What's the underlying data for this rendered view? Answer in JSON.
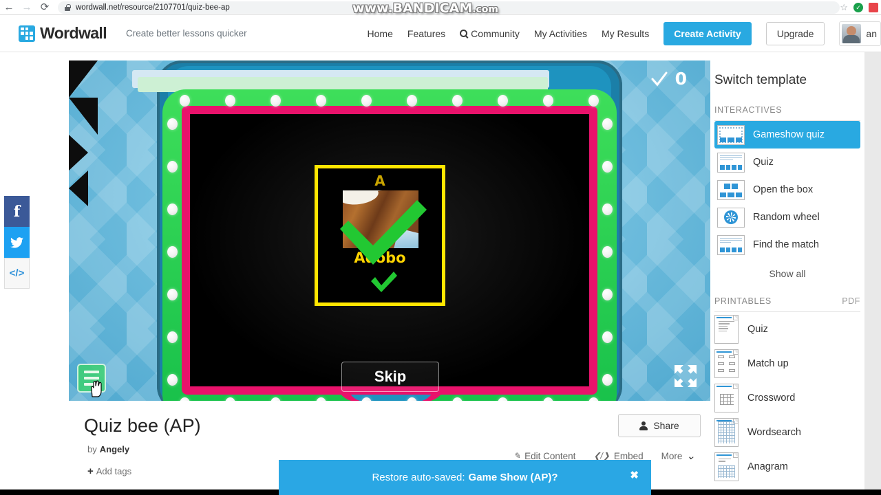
{
  "browser": {
    "back_icon": "back-arrow-icon",
    "forward_icon": "forward-arrow-icon",
    "reload_icon": "reload-icon",
    "lock_icon": "lock-icon",
    "url": "wordwall.net/resource/2107701/quiz-bee-ap",
    "star_icon": "bookmark-star-icon"
  },
  "watermark": {
    "main": "www.BANDICAM",
    "suffix": ".com"
  },
  "header": {
    "logo_text": "Wordwall",
    "tagline": "Create better lessons quicker",
    "nav": [
      {
        "label": "Home"
      },
      {
        "label": "Features"
      },
      {
        "label": "Community"
      },
      {
        "label": "My Activities"
      },
      {
        "label": "My Results"
      }
    ],
    "create_label": "Create Activity",
    "upgrade_label": "Upgrade",
    "username": "an"
  },
  "social": {
    "facebook": "f",
    "twitter": "✉",
    "embed": "</>"
  },
  "game": {
    "score": "0",
    "check_icon": "checkmark-icon",
    "skip_label": "Skip",
    "menu_icon": "hamburger-menu-icon",
    "fullscreen_icon": "fullscreen-expand-icon",
    "card": {
      "letter": "A",
      "answer": "Adobo",
      "correct_icon": "green-check-icon"
    }
  },
  "detail": {
    "title": "Quiz bee (AP)",
    "by_label": "by",
    "author": "Angely",
    "add_tags_label": "Add tags",
    "plus": "+",
    "share_label": "Share",
    "actions": [
      {
        "label": "Edit Content",
        "icon": "pencil-icon"
      },
      {
        "label": "Embed",
        "icon": "code-icon"
      },
      {
        "label": "More",
        "icon": "chevron-down-icon"
      }
    ]
  },
  "restore": {
    "prefix": "Restore auto-saved:",
    "name": "Game Show (AP)?",
    "close": "✖"
  },
  "sidebar": {
    "title": "Switch template",
    "interactives_label": "INTERACTIVES",
    "interactives": [
      {
        "label": "Gameshow quiz",
        "active": true
      },
      {
        "label": "Quiz",
        "active": false
      },
      {
        "label": "Open the box",
        "active": false
      },
      {
        "label": "Random wheel",
        "active": false
      },
      {
        "label": "Find the match",
        "active": false
      }
    ],
    "show_all": "Show all",
    "printables_label": "PRINTABLES",
    "pdf_label": "PDF",
    "printables": [
      {
        "label": "Quiz"
      },
      {
        "label": "Match up"
      },
      {
        "label": "Crossword"
      },
      {
        "label": "Wordsearch"
      },
      {
        "label": "Anagram"
      }
    ]
  },
  "colors": {
    "brand_blue": "#29a9e1",
    "marquee_green": "#17c04a",
    "screen_pink": "#e9126b",
    "card_yellow": "#ffe600",
    "cabinet_blue": "#1e93bf"
  }
}
